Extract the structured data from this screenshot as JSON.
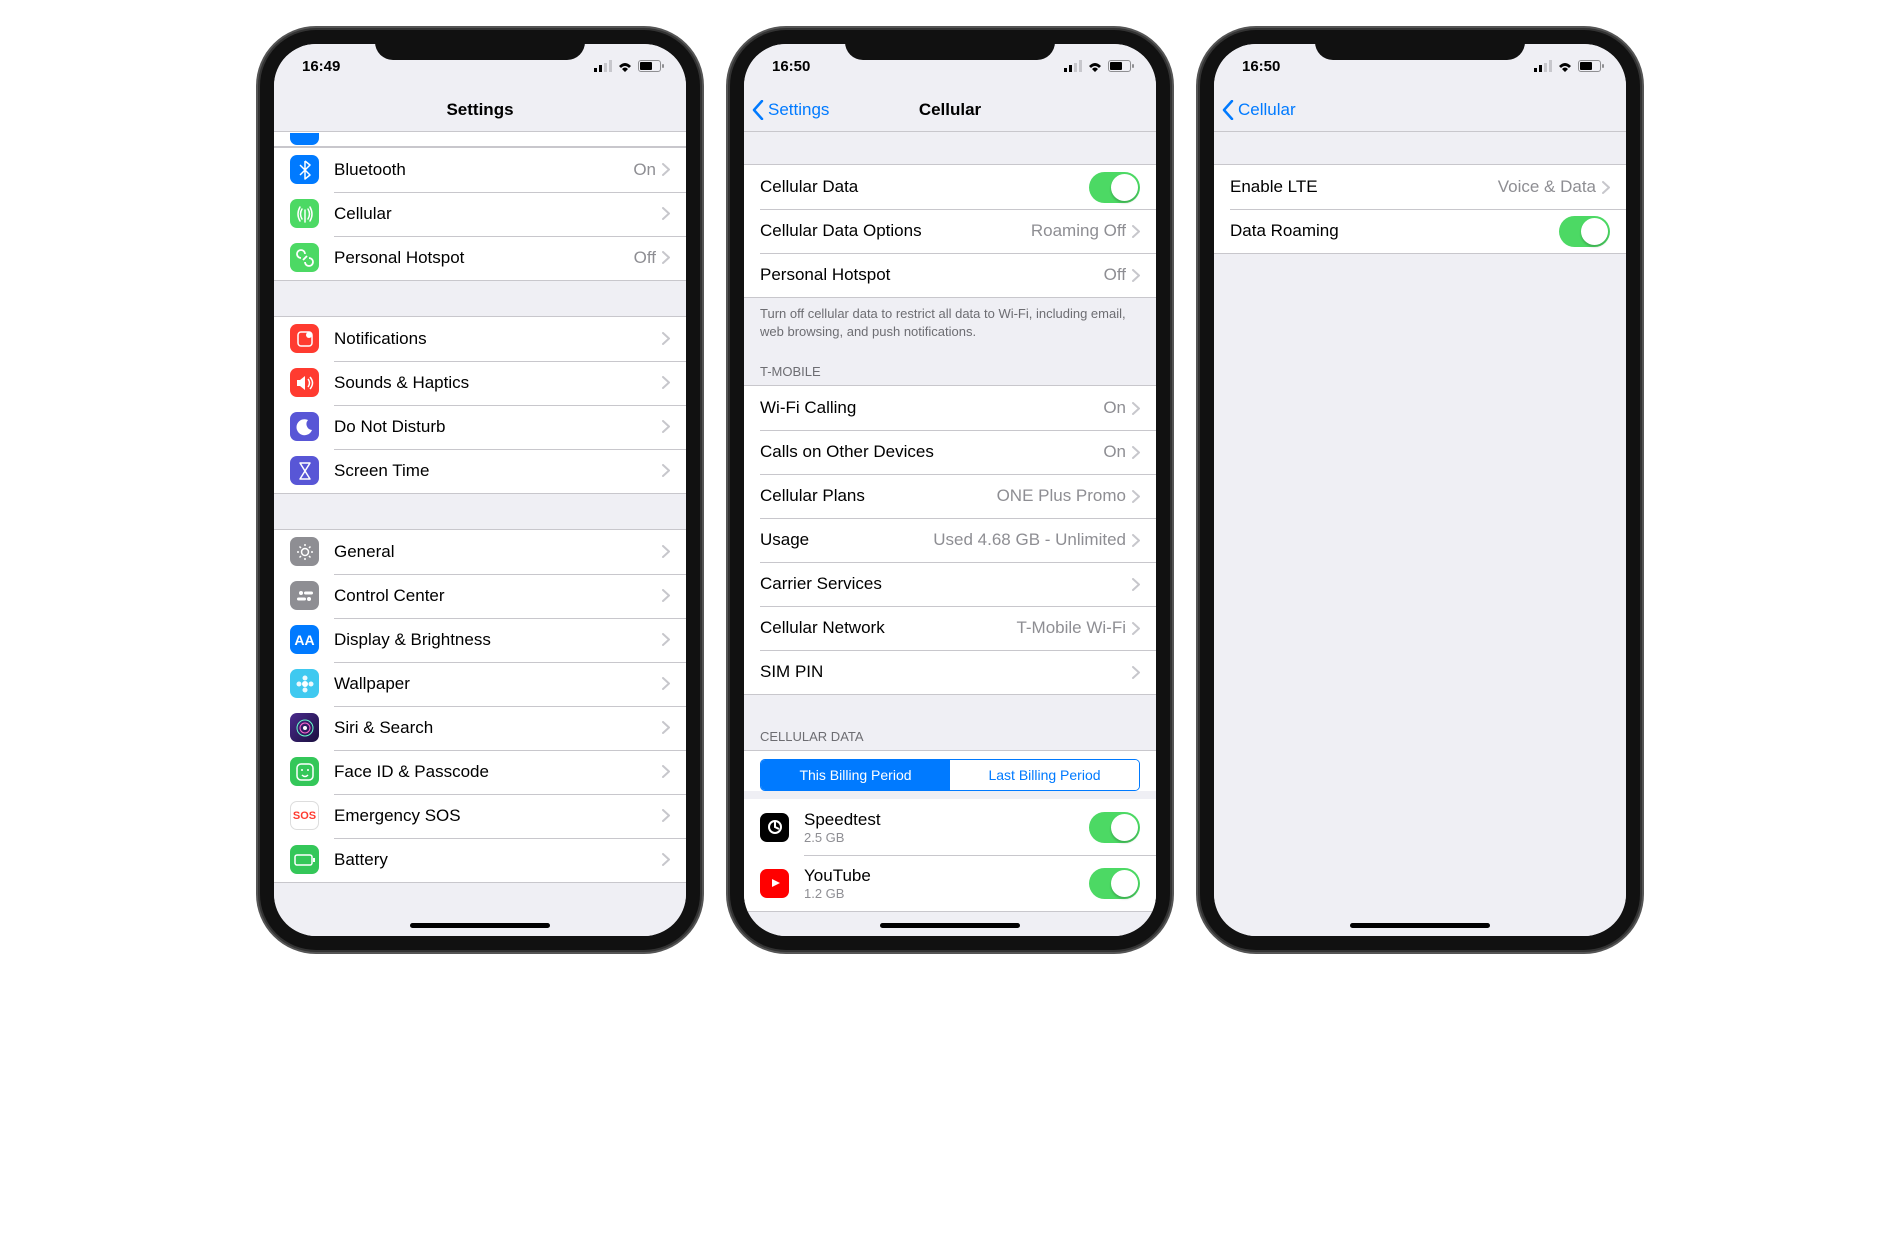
{
  "statusTime1": "16:49",
  "statusTime2": "16:50",
  "statusTime3": "16:50",
  "s1": {
    "title": "Settings",
    "groups": [
      {
        "cells": [
          {
            "label": "Bluetooth",
            "detail": "On",
            "iconColor": "bg-blue",
            "glyph": "bt"
          },
          {
            "label": "Cellular",
            "detail": "",
            "iconColor": "bg-green",
            "glyph": "ant"
          },
          {
            "label": "Personal Hotspot",
            "detail": "Off",
            "iconColor": "bg-green",
            "glyph": "link"
          }
        ]
      },
      {
        "cells": [
          {
            "label": "Notifications",
            "iconColor": "bg-red",
            "glyph": "notif"
          },
          {
            "label": "Sounds & Haptics",
            "iconColor": "bg-red",
            "glyph": "sound"
          },
          {
            "label": "Do Not Disturb",
            "iconColor": "bg-purple",
            "glyph": "moon"
          },
          {
            "label": "Screen Time",
            "iconColor": "bg-purple",
            "glyph": "hourglass"
          }
        ]
      },
      {
        "cells": [
          {
            "label": "General",
            "iconColor": "bg-gray",
            "glyph": "gear"
          },
          {
            "label": "Control Center",
            "iconColor": "bg-gray",
            "glyph": "cc"
          },
          {
            "label": "Display & Brightness",
            "iconColor": "bg-blue",
            "glyph": "aa"
          },
          {
            "label": "Wallpaper",
            "iconColor": "",
            "glyph": "flower",
            "customBg": "#3fc9f0"
          },
          {
            "label": "Siri & Search",
            "iconColor": "bg-siri",
            "glyph": "siri"
          },
          {
            "label": "Face ID & Passcode",
            "iconColor": "bg-lgreen",
            "glyph": "face"
          },
          {
            "label": "Emergency SOS",
            "iconColor": "",
            "glyph": "sos",
            "customBg": "#fff",
            "customColor": "#ff3b30",
            "border": "0.5px solid #ddd"
          },
          {
            "label": "Battery",
            "iconColor": "bg-lgreen",
            "glyph": "bat"
          }
        ]
      }
    ]
  },
  "s2": {
    "backLabel": "Settings",
    "title": "Cellular",
    "group1": {
      "cells": [
        {
          "label": "Cellular Data",
          "type": "toggle",
          "on": true
        },
        {
          "label": "Cellular Data Options",
          "detail": "Roaming Off",
          "type": "disclosure"
        },
        {
          "label": "Personal Hotspot",
          "detail": "Off",
          "type": "disclosure"
        }
      ],
      "footer": "Turn off cellular data to restrict all data to Wi-Fi, including email, web browsing, and push notifications."
    },
    "group2": {
      "header": "T-MOBILE",
      "cells": [
        {
          "label": "Wi-Fi Calling",
          "detail": "On"
        },
        {
          "label": "Calls on Other Devices",
          "detail": "On"
        },
        {
          "label": "Cellular Plans",
          "detail": "ONE Plus Promo"
        },
        {
          "label": "Usage",
          "detail": "Used 4.68 GB - Unlimited"
        },
        {
          "label": "Carrier Services",
          "detail": ""
        },
        {
          "label": "Cellular Network",
          "detail": "T-Mobile Wi-Fi"
        },
        {
          "label": "SIM PIN",
          "detail": ""
        }
      ]
    },
    "group3": {
      "header": "CELLULAR DATA",
      "segmented": {
        "a": "This Billing Period",
        "b": "Last Billing Period",
        "selected": 0
      },
      "apps": [
        {
          "name": "Speedtest",
          "usage": "2.5 GB",
          "iconColor": "bg-black"
        },
        {
          "name": "YouTube",
          "usage": "1.2 GB",
          "iconColor": "bg-yt"
        }
      ]
    }
  },
  "s3": {
    "backLabel": "Cellular",
    "cells": [
      {
        "label": "Enable LTE",
        "detail": "Voice & Data",
        "type": "disclosure"
      },
      {
        "label": "Data Roaming",
        "type": "toggle",
        "on": true
      }
    ]
  }
}
